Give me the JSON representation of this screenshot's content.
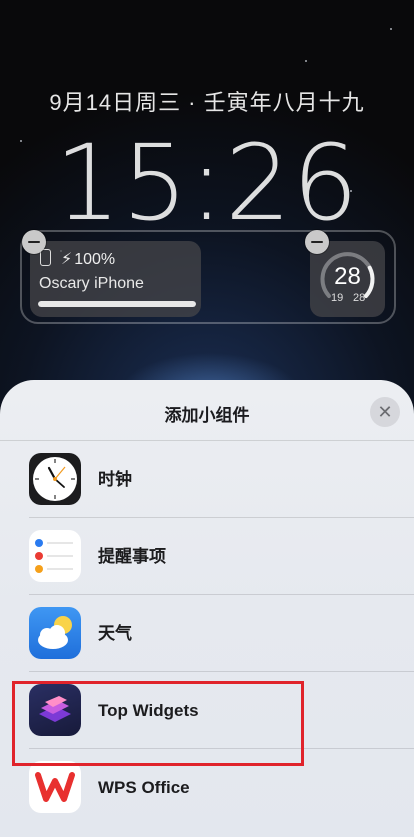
{
  "lock_screen": {
    "date_line": "9月14日周三 · 壬寅年八月十九",
    "time": "15:26",
    "battery_widget": {
      "percent_text": "100%",
      "device_name": "Oscary iPhone",
      "level": 1.0
    },
    "weather_widget": {
      "current": "28",
      "low": "19",
      "high": "28"
    }
  },
  "sheet": {
    "title": "添加小组件",
    "close_icon": "close-icon",
    "apps": [
      {
        "label": "时钟",
        "icon": "clock-icon"
      },
      {
        "label": "提醒事项",
        "icon": "reminders-icon"
      },
      {
        "label": "天气",
        "icon": "weather-icon"
      },
      {
        "label": "Top Widgets",
        "icon": "top-widgets-icon"
      },
      {
        "label": "WPS Office",
        "icon": "wps-office-icon"
      }
    ]
  },
  "colors": {
    "highlight": "#e0232b",
    "weather_icon": "#2f7fe0",
    "wps_red": "#e8302f"
  }
}
